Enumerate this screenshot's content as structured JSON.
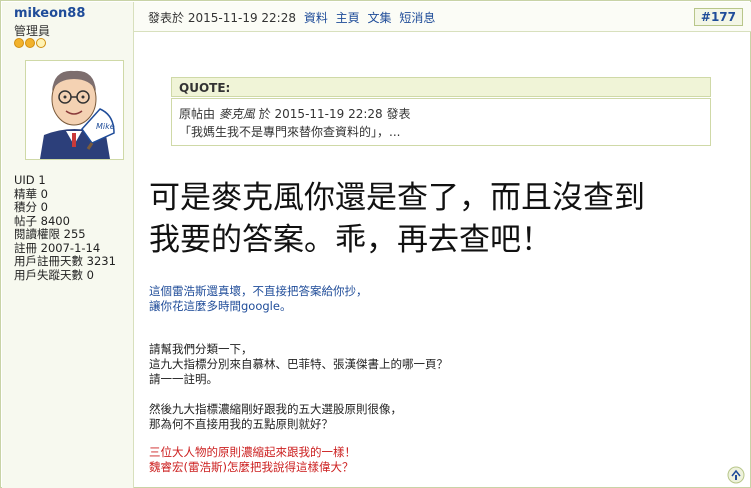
{
  "user": {
    "username": "mikeon88",
    "rank": "管理員",
    "stars": 3,
    "avatar_name": "Mike",
    "stats": [
      "UID 1",
      "精華 0",
      "積分 0",
      "帖子 8400",
      "閱讀權限 255",
      "註冊 2007-1-14",
      "用戶註冊天數 3231",
      "用戶失蹤天數 0"
    ]
  },
  "post": {
    "posted_prefix": "發表於",
    "datetime": "2015-11-19 22:28",
    "links": [
      "資料",
      "主頁",
      "文集",
      "短消息"
    ],
    "post_number": "#177"
  },
  "quote": {
    "title": "QUOTE:",
    "line1_prefix": "原帖由",
    "author": "麥克風",
    "line1_middle": "於",
    "line1_datetime": "2015-11-19 22:28",
    "line1_suffix": "發表",
    "line2": "「我媽生我不是專門來替你查資料的」，..."
  },
  "content": {
    "big_line1": "可是麥克風你還是查了，而且沒查到",
    "big_line2": "我要的答案。乖，再去查吧！",
    "blue_line1": "這個雷浩斯還真壞，不直接把答案給你抄，",
    "blue_line2": "讓你花這麼多時間google。",
    "black_line1": "請幫我們分類一下，",
    "black_line2": "這九大指標分別來自慕林、巴菲特、張漢傑書上的哪一頁？",
    "black_line3": "請一一註明。",
    "black_line4": "然後九大指標濃縮剛好跟我的五大選股原則很像，",
    "black_line5": "那為何不直接用我的五點原則就好？",
    "red_line1": "三位大人物的原則濃縮起來跟我的一樣！",
    "red_line2": "魏睿宏(雷浩斯)怎麼把我說得這樣偉大？"
  },
  "colors": {
    "link": "#1f4c99",
    "red_text": "#cc1f1f",
    "sidebar_bg": "#f7f9ef",
    "quote_head_bg": "#f0f4d7",
    "border": "#cfd9a7"
  },
  "icons": {
    "top": "back-to-top-icon"
  }
}
